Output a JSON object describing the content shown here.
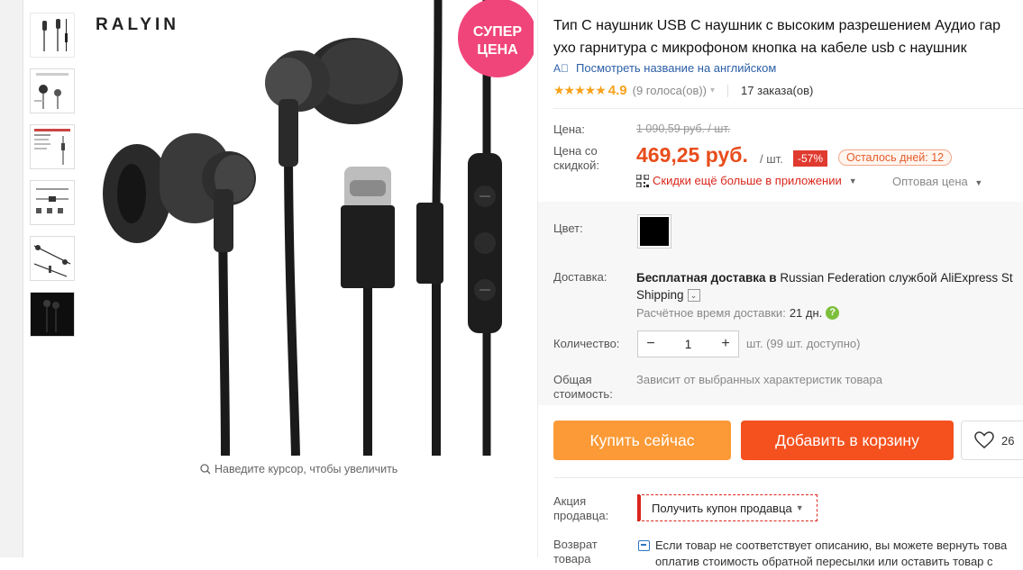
{
  "product": {
    "title_line1": "Тип С наушник USB C наушник с высоким разрешением Аудио гар",
    "title_line2": "ухо гарнитура с микрофоном кнопка на кабеле usb с наушник",
    "translate_link": "Посмотреть название на английском",
    "rating_stars": "★★★★★",
    "rating": "4.9",
    "votes": "(9 голоса(ов))",
    "orders": "17 заказа(ов)"
  },
  "gallery": {
    "brand_logo": "RALYIN",
    "badge_line1": "СУПЕР",
    "badge_line2": "ЦЕНА",
    "zoom_hint": "Наведите курсор, чтобы увеличить"
  },
  "price": {
    "label": "Цена:",
    "old": "1 090,59 руб. / шт.",
    "discount_label_1": "Цена со",
    "discount_label_2": "скидкой:",
    "new": "469,25 руб.",
    "per_unit": "/ шт.",
    "discount": "-57%",
    "days_left": "Осталось дней: 12",
    "app_discount": "Скидки ещё больше в приложении",
    "wholesale": "Оптовая цена"
  },
  "props": {
    "color_label": "Цвет:",
    "delivery_label": "Доставка:",
    "delivery_bold": "Бесплатная доставка в",
    "delivery_rest": "Russian Federation службой AliExpress St",
    "delivery_line2": "Shipping",
    "eta_label": "Расчётное время доставки:",
    "eta_days": "21 дн.",
    "qty_label": "Количество:",
    "qty_value": "1",
    "qty_available": "шт. (99 шт. доступно)",
    "total_label_1": "Общая",
    "total_label_2": "стоимость:",
    "total_text": "Зависит от выбранных характеристик товара"
  },
  "actions": {
    "buy_now": "Купить сейчас",
    "add_to_cart": "Добавить в корзину",
    "wishlist_count": "26"
  },
  "seller": {
    "promo_label_1": "Акция",
    "promo_label_2": "продавца:",
    "coupon_button": "Получить купон продавца",
    "return_label_1": "Возврат",
    "return_label_2": "товара",
    "return_line1": "Если товар не соответствует описанию, вы можете вернуть това",
    "return_line2": "оплатив стоимость обратной пересылки или оставить товар с"
  },
  "colors": {
    "price_accent": "#e84d1c",
    "discount_badge": "#e03a2f",
    "buy_button": "#fb9a36",
    "cart_button": "#f4511e",
    "badge_pink": "#f0457a",
    "star": "#f7a21b",
    "link": "#2b5ea7"
  }
}
